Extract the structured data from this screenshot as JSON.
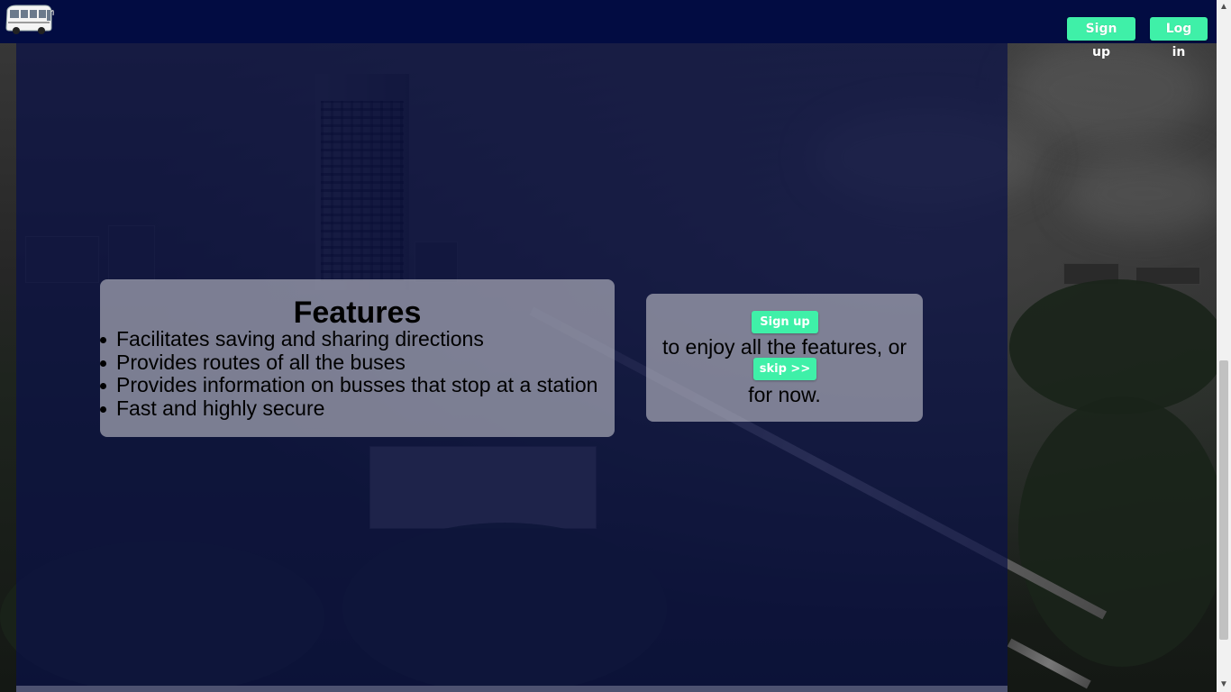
{
  "header": {
    "logo_icon": "bus-icon",
    "signup_label": "Sign up",
    "login_label": "Log in"
  },
  "features": {
    "title": "Features",
    "items": [
      "Facilitates saving and sharing directions",
      "Provides routes of all the buses",
      "Provides information on busses that stop at a station",
      "Fast and highly secure"
    ]
  },
  "cta": {
    "signup_label": "Sign up",
    "text_after_signup": "to enjoy all the features, or",
    "skip_label": "skip >>",
    "text_after_skip": "for now."
  },
  "colors": {
    "header_bg": "#020c42",
    "button_bg": "#3ff0a8",
    "overlay": "#0a1046"
  },
  "scrollbar": {
    "up_icon": "chevron-up-icon",
    "down_icon": "chevron-down-icon"
  }
}
